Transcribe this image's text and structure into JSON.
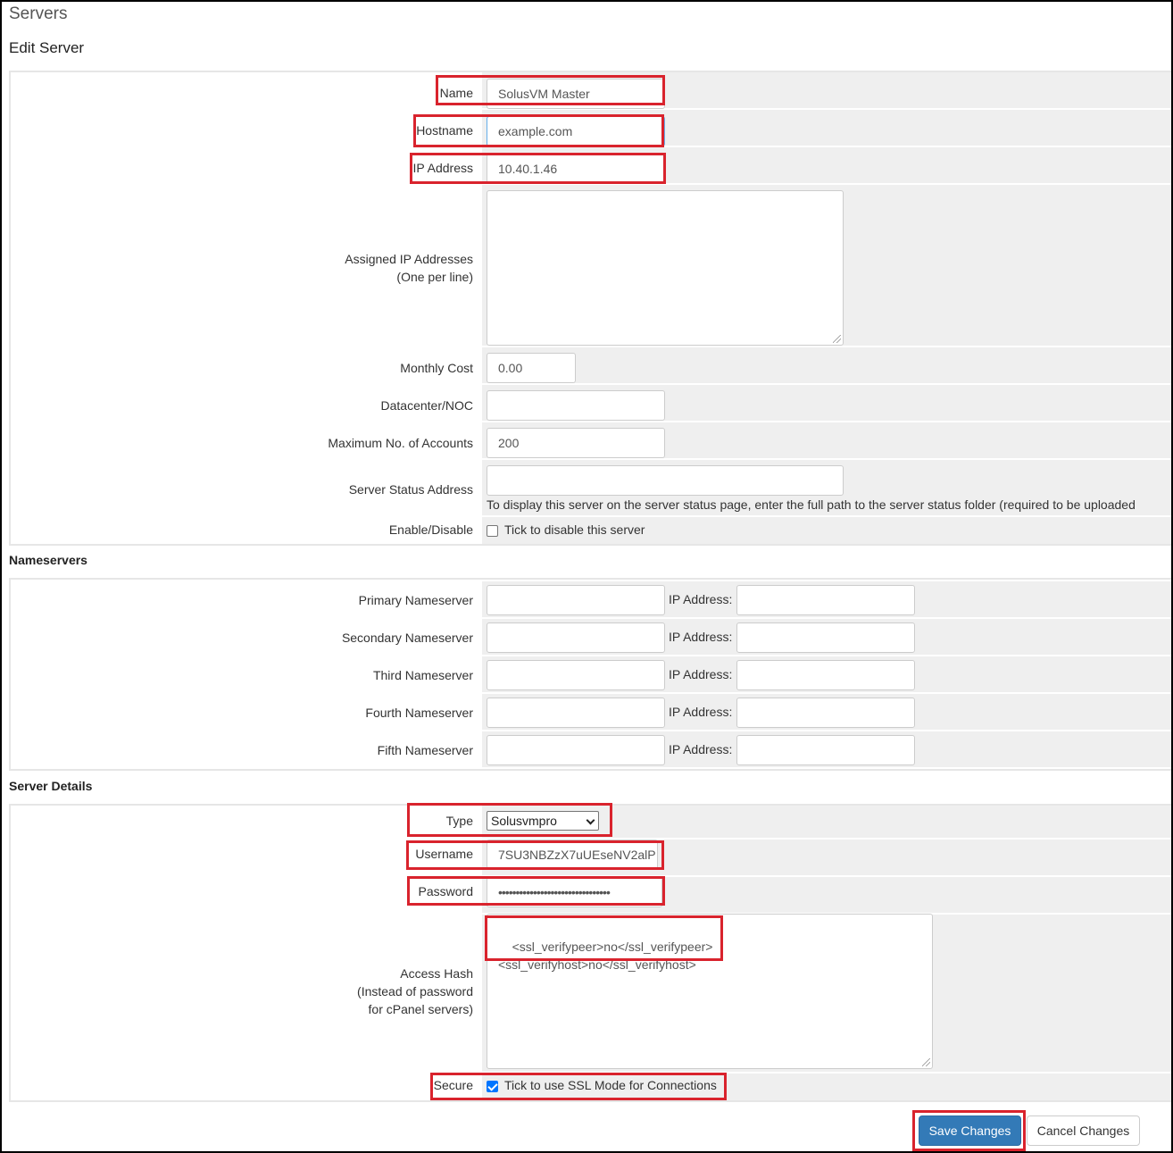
{
  "header": {
    "title": "Servers",
    "subtitle": "Edit Server"
  },
  "server": {
    "name_label": "Name",
    "name_value": "SolusVM Master",
    "hostname_label": "Hostname",
    "hostname_value": "example.com",
    "ip_label": "IP Address",
    "ip_value": "10.40.1.46",
    "assigned_label_1": "Assigned IP Addresses",
    "assigned_label_2": "(One per line)",
    "monthly_label": "Monthly Cost",
    "monthly_value": "0.00",
    "datacenter_label": "Datacenter/NOC",
    "datacenter_value": "",
    "maxacc_label": "Maximum No. of Accounts",
    "maxacc_value": "200",
    "status_label": "Server Status Address",
    "status_value": "",
    "status_help": "To display this server on the server status page, enter the full path to the server status folder (required to be uploaded",
    "enable_label": "Enable/Disable",
    "enable_text": "Tick to disable this server"
  },
  "nameservers": {
    "title": "Nameservers",
    "ip_label": "IP Address:",
    "rows": [
      {
        "label": "Primary Nameserver"
      },
      {
        "label": "Secondary Nameserver"
      },
      {
        "label": "Third Nameserver"
      },
      {
        "label": "Fourth Nameserver"
      },
      {
        "label": "Fifth Nameserver"
      }
    ]
  },
  "details": {
    "title": "Server Details",
    "type_label": "Type",
    "type_value": "Solusvmpro",
    "username_label": "Username",
    "username_value": "7SU3NBZzX7uUEseNV2alP",
    "password_label": "Password",
    "password_value": "••••••••••••••••••••••••••••••••",
    "hash_label_1": "Access Hash",
    "hash_label_2": "(Instead of password",
    "hash_label_3": "for cPanel servers)",
    "hash_value": "<ssl_verifypeer>no</ssl_verifypeer>\n<ssl_verifyhost>no</ssl_verifyhost>",
    "secure_label": "Secure",
    "secure_text": "Tick to use SSL Mode for Connections"
  },
  "actions": {
    "save": "Save Changes",
    "cancel": "Cancel Changes"
  },
  "colors": {
    "accent": "#337ab7",
    "highlight": "#d9232d",
    "row_bg": "#efefef"
  }
}
